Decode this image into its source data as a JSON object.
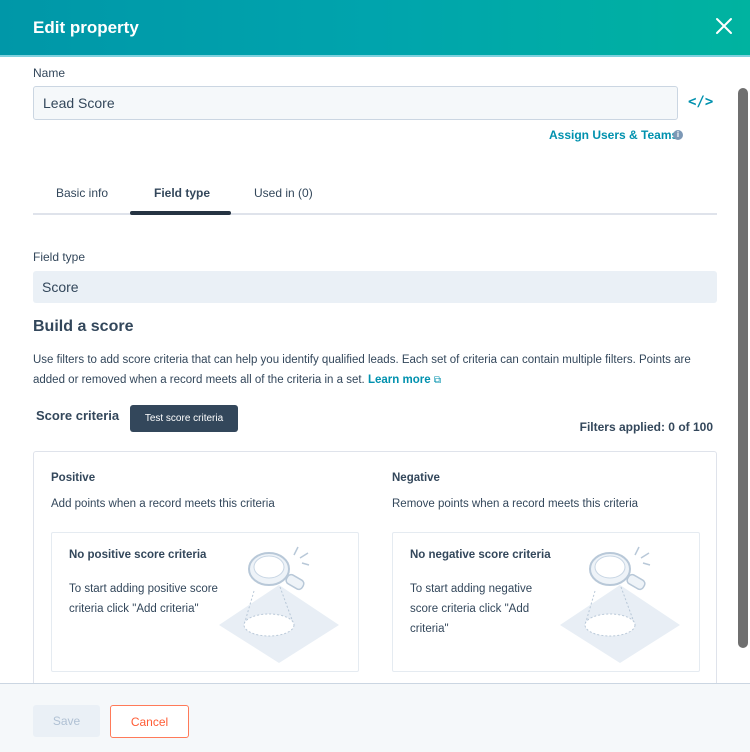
{
  "header": {
    "title": "Edit property",
    "close_icon": "close-icon"
  },
  "name_field": {
    "label": "Name",
    "value": "Lead Score",
    "code_icon": "</>"
  },
  "assign": {
    "label": "Assign Users & Teams",
    "info_icon": "i"
  },
  "tabs": [
    {
      "label": "Basic info",
      "active": false
    },
    {
      "label": "Field type",
      "active": true
    },
    {
      "label": "Used in (0)",
      "active": false
    }
  ],
  "field_type": {
    "label": "Field type",
    "value": "Score"
  },
  "build": {
    "title": "Build a score",
    "description": "Use filters to add score criteria that can help you identify qualified leads. Each set of criteria can contain multiple filters. Points are added or removed when a record meets all of the criteria in a set.",
    "learn_more": "Learn more",
    "external_icon": "⧉"
  },
  "score_criteria": {
    "label": "Score criteria",
    "test_button": "Test score criteria",
    "filters_applied": "Filters applied: 0 of 100"
  },
  "positive": {
    "title": "Positive",
    "subtitle": "Add points when a record meets this criteria",
    "empty_title": "No positive score criteria",
    "empty_text": "To start adding positive score criteria click \"Add criteria\""
  },
  "negative": {
    "title": "Negative",
    "subtitle": "Remove points when a record meets this criteria",
    "empty_title": "No negative score criteria",
    "empty_text": "To start adding negative score criteria click \"Add criteria\""
  },
  "footer": {
    "save": "Save",
    "cancel": "Cancel"
  },
  "colors": {
    "accent": "#0091ae",
    "header_start": "#0097a8",
    "header_end": "#00b3a0",
    "cancel": "#ff5c35",
    "dark_button": "#33475b"
  }
}
